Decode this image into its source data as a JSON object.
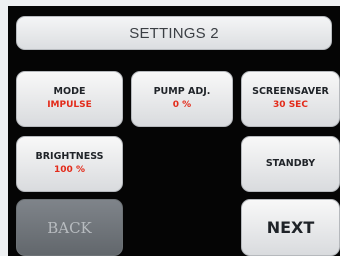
{
  "header": {
    "title": "SETTINGS 2"
  },
  "settings": {
    "mode": {
      "label": "MODE",
      "value": "IMPULSE"
    },
    "pump_adj": {
      "label": "PUMP ADJ.",
      "value": "0 %"
    },
    "screensaver": {
      "label": "SCREENSAVER",
      "value": "30 SEC"
    },
    "brightness": {
      "label": "BRIGHTNESS",
      "value": "100 %"
    },
    "standby": {
      "label": "STANDBY"
    }
  },
  "navigation": {
    "back_label": "BACK",
    "next_label": "NEXT"
  },
  "colors": {
    "screen_background": "#050505",
    "button_face": "#e6e7e9",
    "value_text": "#e32b1a",
    "disabled_button": "#72777c"
  }
}
